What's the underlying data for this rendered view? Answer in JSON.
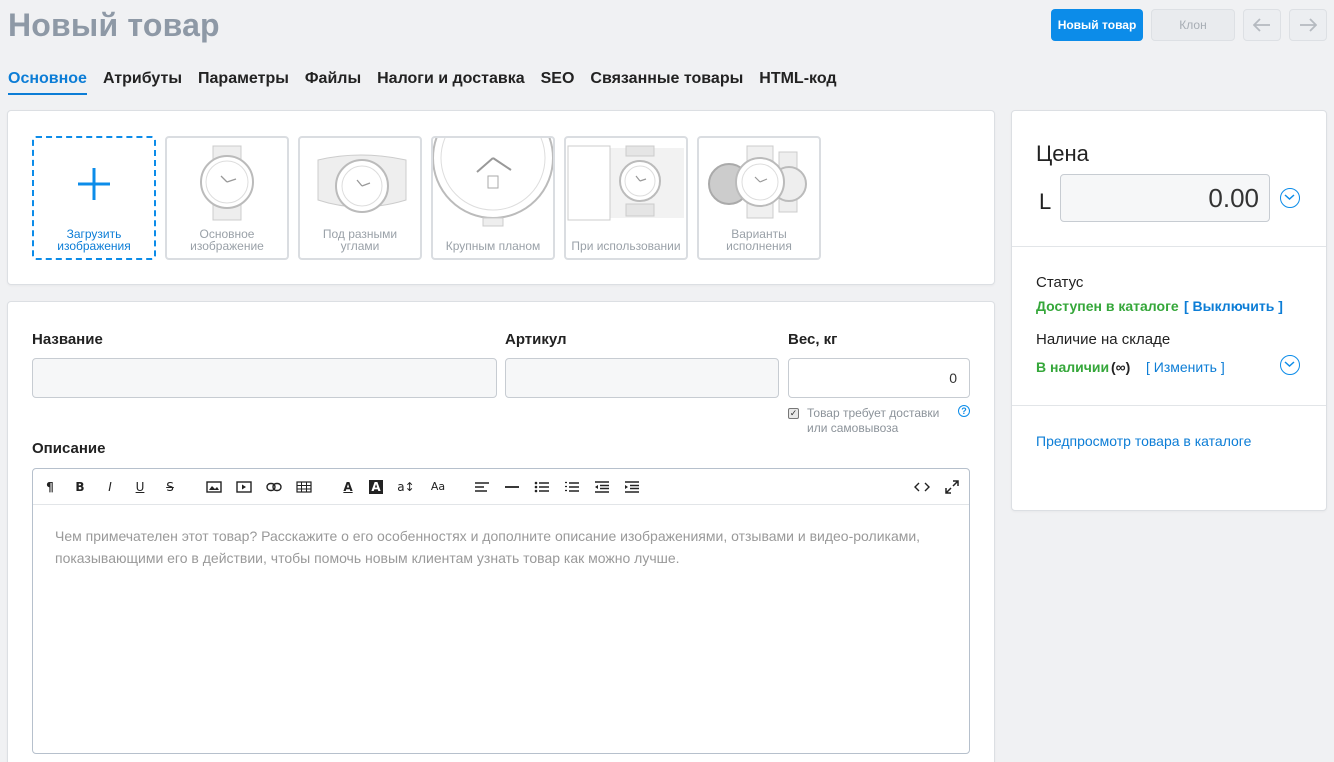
{
  "header": {
    "title": "Новый товар",
    "new_product_btn": "Новый товар",
    "clone_btn": "Клон",
    "back_icon": "arrow-left-icon",
    "forward_icon": "arrow-right-icon"
  },
  "tabs": [
    {
      "label": "Основное",
      "active": true
    },
    {
      "label": "Атрибуты"
    },
    {
      "label": "Параметры"
    },
    {
      "label": "Файлы"
    },
    {
      "label": "Налоги и доставка"
    },
    {
      "label": "SEO"
    },
    {
      "label": "Связанные товары"
    },
    {
      "label": "HTML-код"
    }
  ],
  "images": {
    "upload_label": "Загрузить изображения",
    "slots": [
      {
        "label": "Основное изображение"
      },
      {
        "label": "Под разными углами"
      },
      {
        "label": "Крупным планом"
      },
      {
        "label": "При использовании"
      },
      {
        "label": "Варианты исполнения"
      }
    ]
  },
  "form": {
    "name_label": "Название",
    "name_value": "",
    "sku_label": "Артикул",
    "sku_value": "",
    "weight_label": "Вес, кг",
    "weight_value": "0",
    "shipping_checkbox": "Товар требует доставки или самовывоза",
    "shipping_checked": true,
    "help_icon": "?",
    "description_label": "Описание",
    "description_placeholder": "Чем примечателен этот товар? Расскажите о его особенностях и дополните описание изображениями, отзывами и видео-роликами, показывающими его в действии, чтобы помочь новым клиентам узнать товар как можно лучше."
  },
  "toolbar": {
    "items": [
      "¶",
      "B",
      "I",
      "U",
      "S",
      "image",
      "video",
      "link",
      "table",
      "A",
      "A",
      "a↕",
      "Aa",
      "align",
      "—",
      "•",
      "1.",
      "outdent",
      "indent",
      "<>",
      "expand"
    ]
  },
  "sidebar": {
    "price_title": "Цена",
    "currency": "L",
    "price_value": "0.00",
    "status_label": "Статус",
    "status_value": "Доступен в каталоге",
    "status_action": "[ Выключить ]",
    "stock_label": "Наличие на складе",
    "stock_value": "В наличии",
    "stock_extra": "(∞)",
    "stock_action": "[ Изменить ]",
    "preview_link": "Предпросмотр товара в каталоге"
  },
  "colors": {
    "accent": "#0c8ce9",
    "title_gray": "#8e99a6",
    "green": "#35a73a",
    "background": "#f0f1f3"
  }
}
